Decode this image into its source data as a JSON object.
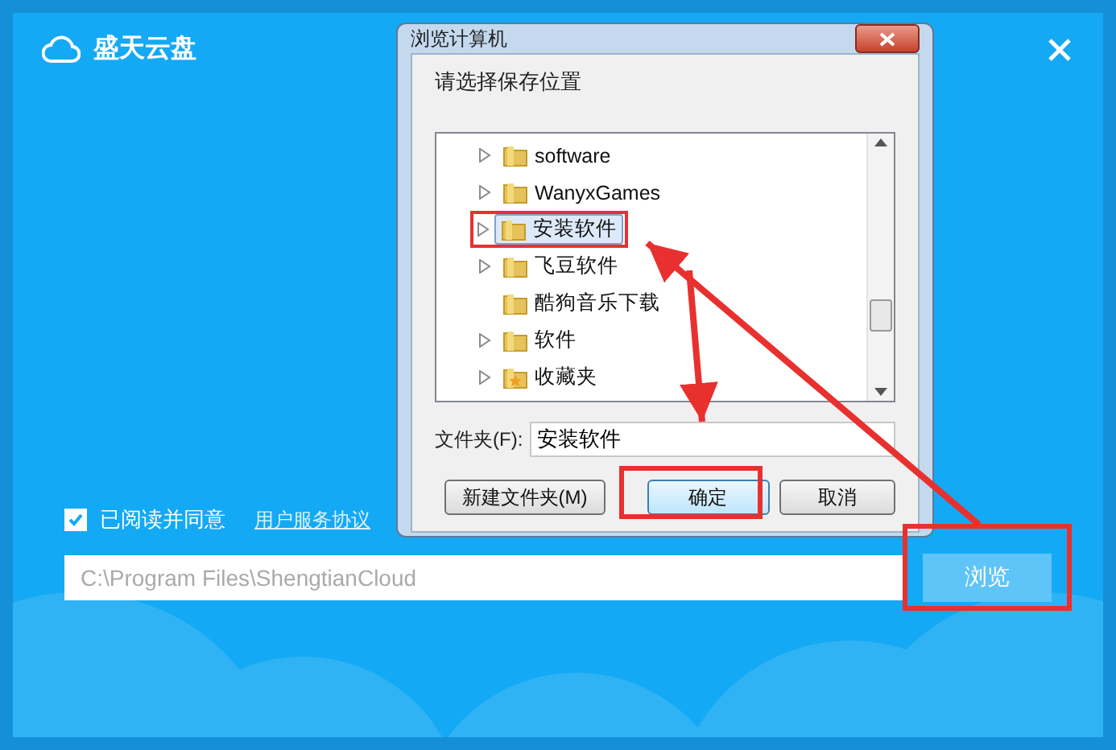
{
  "app": {
    "title": "盛天云盘",
    "agreement": {
      "checked": true,
      "label": "已阅读并同意",
      "link": "用户服务协议"
    },
    "install_path": {
      "value": "C:\\Program Files\\ShengtianCloud"
    },
    "browse_button": "浏览"
  },
  "dialog": {
    "title": "浏览计算机",
    "prompt": "请选择保存位置",
    "tree": [
      {
        "label": "software",
        "kind": "folder",
        "expandable": true,
        "selected": false
      },
      {
        "label": "WanyxGames",
        "kind": "folder",
        "expandable": true,
        "selected": false
      },
      {
        "label": "安装软件",
        "kind": "folder",
        "expandable": true,
        "selected": true
      },
      {
        "label": "飞豆软件",
        "kind": "folder",
        "expandable": true,
        "selected": false
      },
      {
        "label": "酷狗音乐下载",
        "kind": "folder",
        "expandable": false,
        "selected": false
      },
      {
        "label": "软件",
        "kind": "folder",
        "expandable": true,
        "selected": false
      },
      {
        "label": "收藏夹",
        "kind": "favorites",
        "expandable": true,
        "selected": false
      }
    ],
    "folder_field": {
      "label": "文件夹(F):",
      "value": "安装软件"
    },
    "buttons": [
      {
        "label": "新建文件夹(M)",
        "default": false
      },
      {
        "label": "确定",
        "default": true
      },
      {
        "label": "取消",
        "default": false
      }
    ]
  }
}
